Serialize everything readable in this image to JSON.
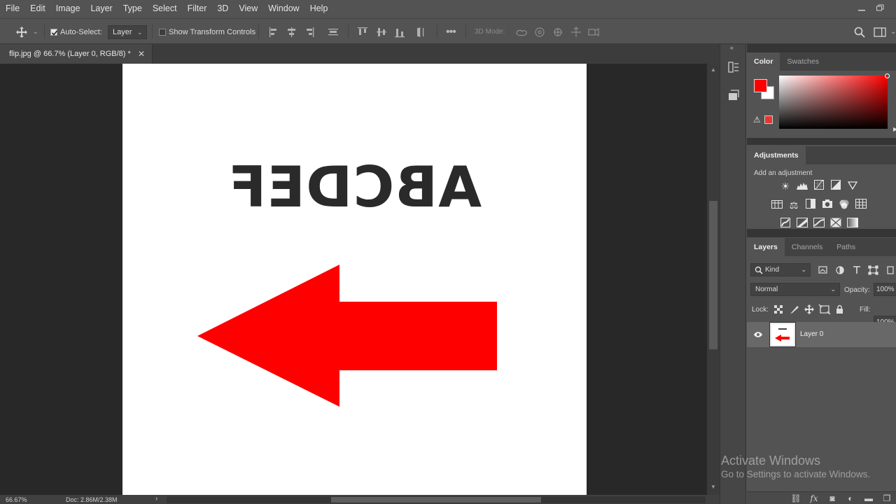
{
  "menu": {
    "items": [
      "File",
      "Edit",
      "Image",
      "Layer",
      "Type",
      "Select",
      "Filter",
      "3D",
      "View",
      "Window",
      "Help"
    ]
  },
  "options": {
    "auto_select_label": "Auto-Select:",
    "auto_select_checked": true,
    "target_value": "Layer",
    "show_transform_label": "Show Transform Controls",
    "show_transform_checked": false,
    "mode_3d_label": "3D Mode:"
  },
  "document": {
    "tab_title": "flip.jpg @ 66.7% (Layer 0, RGB/8) *",
    "canvas_text": "ABCDEF",
    "text_color": "#2a2a2a",
    "arrow_color": "#ff0000"
  },
  "status": {
    "zoom": "66.67%",
    "doc_info": "Doc: 2.86M/2.38M"
  },
  "color_panel": {
    "tabs": [
      "Color",
      "Swatches"
    ],
    "foreground": "#ff0000",
    "background": "#ffffff"
  },
  "adjustments_panel": {
    "tab": "Adjustments",
    "hint": "Add an adjustment"
  },
  "layers_panel": {
    "tabs": [
      "Layers",
      "Channels",
      "Paths"
    ],
    "filter_kind": "Kind",
    "blend_mode": "Normal",
    "opacity_label": "Opacity:",
    "opacity_value": "100%",
    "lock_label": "Lock:",
    "fill_label": "Fill:",
    "fill_value": "100%",
    "layers": [
      {
        "name": "Layer 0",
        "visible": true
      }
    ]
  },
  "watermark": {
    "title": "Activate Windows",
    "subtitle": "Go to Settings to activate Windows."
  }
}
